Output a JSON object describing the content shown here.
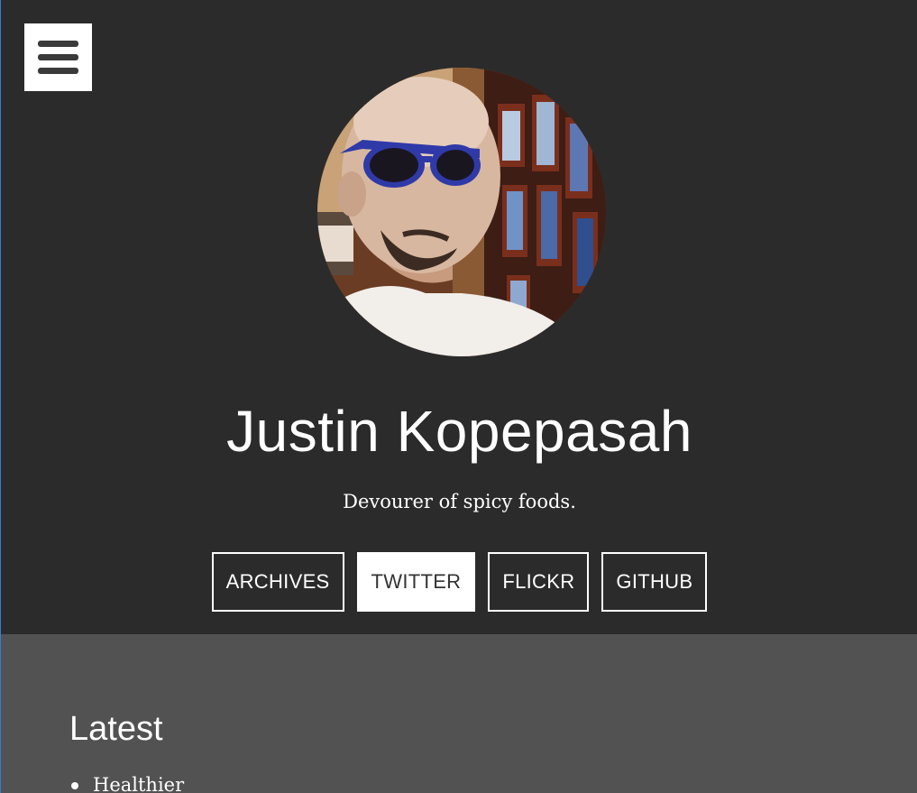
{
  "profile": {
    "name": "Justin Kopepasah",
    "tagline": "Devourer of spicy foods."
  },
  "nav": {
    "menu_icon": "hamburger-menu-icon",
    "links": [
      {
        "label": "Archives",
        "active": false
      },
      {
        "label": "Twitter",
        "active": true
      },
      {
        "label": "Flickr",
        "active": false
      },
      {
        "label": "GitHub",
        "active": false
      }
    ]
  },
  "latest": {
    "title": "Latest",
    "posts": [
      "Healthier"
    ]
  },
  "colors": {
    "hero_bg": "#2b2b2b",
    "content_bg": "#525252",
    "text": "#ffffff"
  }
}
